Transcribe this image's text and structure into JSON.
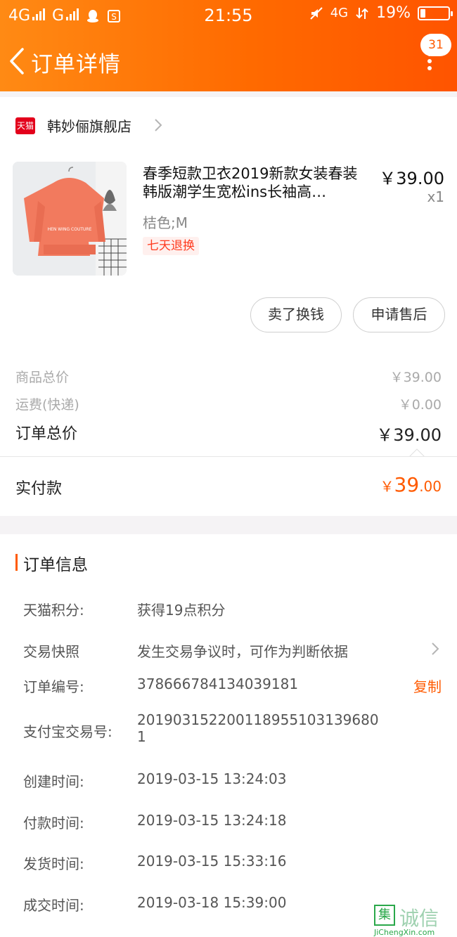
{
  "status_bar": {
    "left_signals": [
      "4G",
      "G"
    ],
    "time": "21:55",
    "network": "4G",
    "battery_percent": "19%",
    "battery_level": 0.19
  },
  "nav": {
    "title": "订单详情",
    "notification_count": "31"
  },
  "store": {
    "logo_text": "天猫",
    "name": "韩妙俪旗舰店"
  },
  "product": {
    "title": "春季短款卫衣2019新款女装春装韩版潮学生宽松ins长袖高…",
    "price": "￥39.00",
    "quantity": "x1",
    "sku": "桔色;M",
    "return_tag": "七天退换",
    "image_print_text": "HEN WING COUTURE",
    "image_color": "#f27a5e"
  },
  "actions": {
    "sell_label": "卖了换钱",
    "aftersale_label": "申请售后"
  },
  "fees": {
    "goods_label": "商品总价",
    "goods_value": "￥39.00",
    "shipping_label": "运费(快递)",
    "shipping_value": "￥0.00",
    "total_label": "订单总价",
    "total_value": "￥39.00",
    "paid_label": "实付款",
    "paid_yen": "￥",
    "paid_int": "39",
    "paid_dec": ".00"
  },
  "order_info": {
    "section_title": "订单信息",
    "rows": [
      {
        "label": "天猫积分:",
        "value": "获得19点积分"
      },
      {
        "label": "交易快照",
        "value": "发生交易争议时，可作为判断依据"
      },
      {
        "label": "订单编号:",
        "value": "378666784134039181",
        "action": "复制"
      },
      {
        "label": "支付宝交易号:",
        "value": "2019031522001189551031396801"
      },
      {
        "label": "创建时间:",
        "value": "2019-03-15 13:24:03"
      },
      {
        "label": "付款时间:",
        "value": "2019-03-15 13:24:18"
      },
      {
        "label": "发货时间:",
        "value": "2019-03-15 15:33:16"
      },
      {
        "label": "成交时间:",
        "value": "2019-03-18 15:39:00"
      }
    ]
  },
  "watermark": {
    "box_char": "集",
    "text": "诚信",
    "url": "JiChengXin.com"
  },
  "colors": {
    "brand_orange": "#ff6a00",
    "price_orange": "#ff5a00",
    "tmall_red": "#e3001b"
  }
}
